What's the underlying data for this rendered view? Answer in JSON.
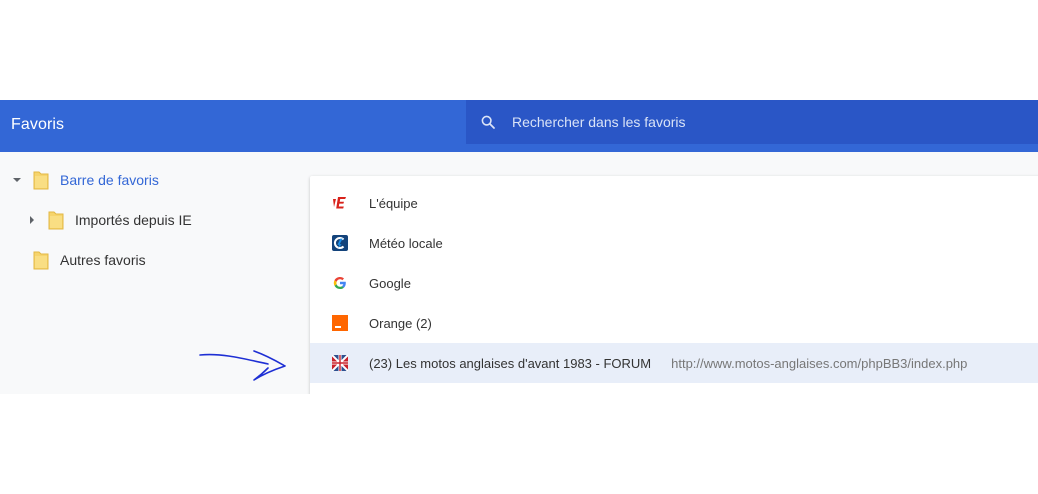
{
  "header": {
    "title": "Favoris",
    "search": {
      "placeholder": "Rechercher dans les favoris",
      "value": ""
    }
  },
  "tree": {
    "items": [
      {
        "label": "Barre de favoris",
        "expanded": true,
        "selected": true,
        "icon": "folder-icon"
      },
      {
        "label": "Importés depuis IE",
        "expanded": false,
        "selected": false,
        "icon": "folder-icon"
      },
      {
        "label": "Autres favoris",
        "expanded": null,
        "selected": false,
        "icon": "folder-icon"
      }
    ]
  },
  "bookmarks": [
    {
      "title": "L'équipe",
      "url": "",
      "icon": "lequipe-favicon",
      "highlighted": false
    },
    {
      "title": "Météo locale",
      "url": "",
      "icon": "meteo-favicon",
      "highlighted": false
    },
    {
      "title": "Google",
      "url": "",
      "icon": "google-favicon",
      "highlighted": false
    },
    {
      "title": "Orange (2)",
      "url": "",
      "icon": "orange-favicon",
      "highlighted": false
    },
    {
      "title": "(23) Les motos anglaises d'avant 1983 - FORUM",
      "url": "http://www.motos-anglaises.com/phpBB3/index.php",
      "icon": "forum-favicon",
      "highlighted": true
    }
  ],
  "colors": {
    "header": "#3367d6",
    "search": "#2a56c6",
    "folder": "#f6d46c",
    "highlight": "#e8eef9",
    "annotation_arrow": "#1e2fd4"
  }
}
